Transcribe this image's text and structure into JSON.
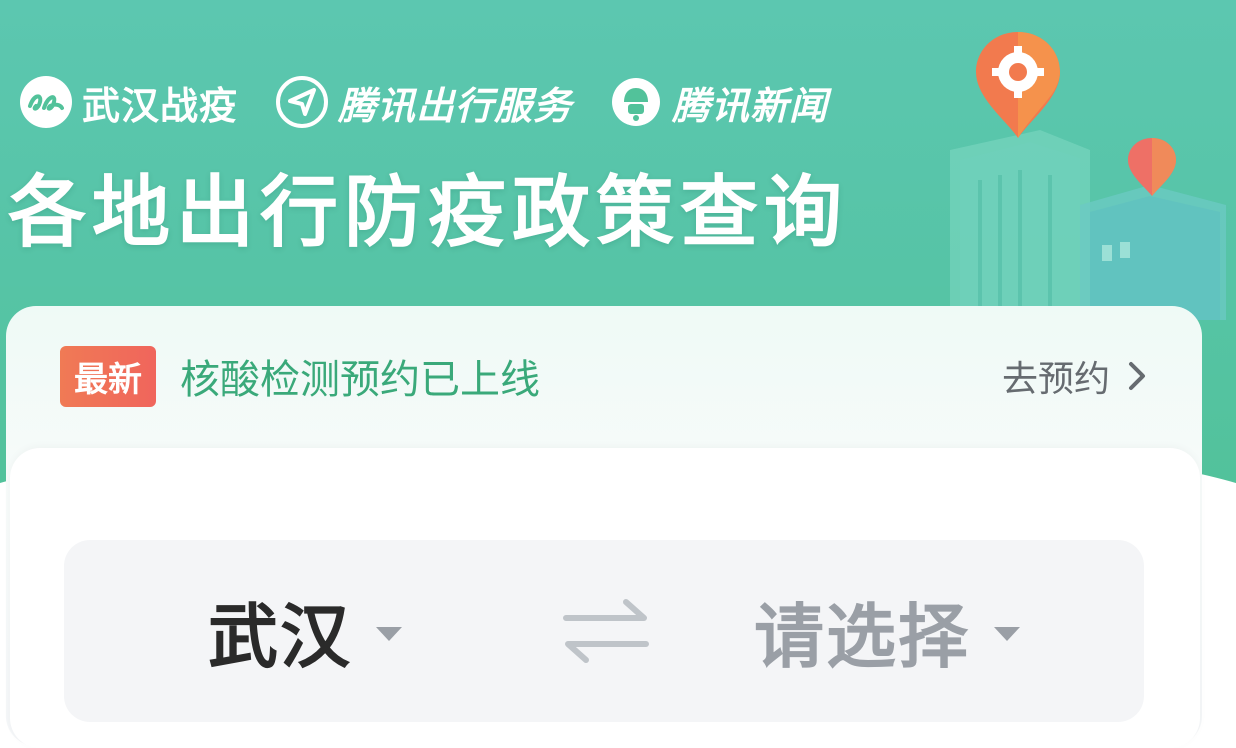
{
  "header": {
    "brands": [
      {
        "label": "武汉战疫",
        "icon": "wuhan-fight-logo-icon"
      },
      {
        "label": "腾讯出行服务",
        "icon": "send-arrow-icon"
      },
      {
        "label": "腾讯新闻",
        "icon": "tencent-news-icon"
      }
    ],
    "title": "各地出行防疫政策查询"
  },
  "notice": {
    "badge": "最新",
    "text": "核酸检测预约已上线",
    "link_label": "去预约"
  },
  "route": {
    "from": "武汉",
    "to": "请选择"
  },
  "colors": {
    "banner_green": "#56c4a6",
    "notice_green": "#3aa97a",
    "badge_orange": "#f06e58",
    "placeholder_gray": "#9a9fa6"
  }
}
